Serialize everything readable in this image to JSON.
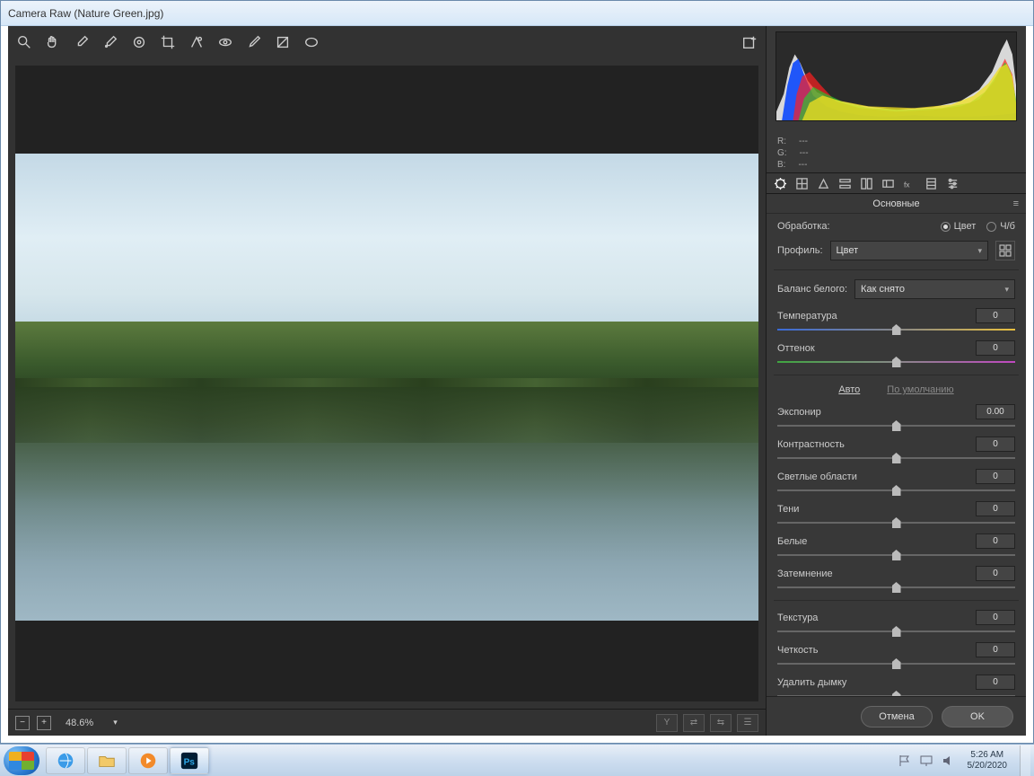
{
  "title": "Camera Raw (Nature Green.jpg)",
  "zoom": "48.6%",
  "rgb": {
    "r_label": "R:",
    "g_label": "G:",
    "b_label": "B:",
    "dash": "---"
  },
  "panel_title": "Основные",
  "treatment": {
    "label": "Обработка:",
    "color": "Цвет",
    "bw": "Ч/б"
  },
  "profile": {
    "label": "Профиль:",
    "value": "Цвет"
  },
  "wb": {
    "label": "Баланс белого:",
    "value": "Как снято"
  },
  "sliders": {
    "temp": {
      "label": "Температура",
      "val": "0"
    },
    "tint": {
      "label": "Оттенок",
      "val": "0"
    },
    "exposure": {
      "label": "Экспонир",
      "val": "0.00"
    },
    "contrast": {
      "label": "Контрастность",
      "val": "0"
    },
    "highlights": {
      "label": "Светлые области",
      "val": "0"
    },
    "shadows": {
      "label": "Тени",
      "val": "0"
    },
    "whites": {
      "label": "Белые",
      "val": "0"
    },
    "blacks": {
      "label": "Затемнение",
      "val": "0"
    },
    "texture": {
      "label": "Текстура",
      "val": "0"
    },
    "clarity": {
      "label": "Четкость",
      "val": "0"
    },
    "dehaze": {
      "label": "Удалить дымку",
      "val": "0"
    }
  },
  "links": {
    "auto": "Авто",
    "default": "По умолчанию"
  },
  "buttons": {
    "cancel": "Отмена",
    "ok": "OK"
  },
  "bottom_bar_y": "Y",
  "taskbar": {
    "time": "5:26 AM",
    "date": "5/20/2020"
  }
}
